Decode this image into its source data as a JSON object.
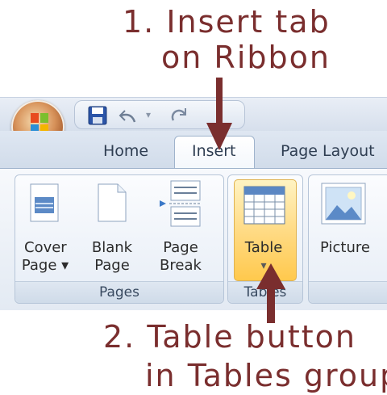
{
  "annotations": {
    "step1_line1": "1. Insert tab",
    "step1_line2": "on Ribbon",
    "step2_line1": "2. Table button",
    "step2_line2": "in Tables group"
  },
  "quick_access": {
    "save_icon": "save-icon",
    "undo_icon": "undo-icon",
    "redo_icon": "redo-icon",
    "customize_icon": "customize-icon"
  },
  "tabs": [
    {
      "label": "Home"
    },
    {
      "label": "Insert",
      "selected": true
    },
    {
      "label": "Page Layout"
    }
  ],
  "groups": {
    "pages": {
      "label": "Pages",
      "buttons": [
        {
          "line1": "Cover",
          "line2": "Page ▾"
        },
        {
          "line1": "Blank",
          "line2": "Page"
        },
        {
          "line1": "Page",
          "line2": "Break"
        }
      ]
    },
    "tables": {
      "label": "Tables",
      "buttons": [
        {
          "line1": "Table",
          "line2": "▾"
        }
      ]
    },
    "illustrations": {
      "buttons": [
        {
          "line1": "Picture"
        }
      ]
    }
  },
  "colors": {
    "annotation": "#7a2e2e",
    "highlight": "#ffd980"
  }
}
